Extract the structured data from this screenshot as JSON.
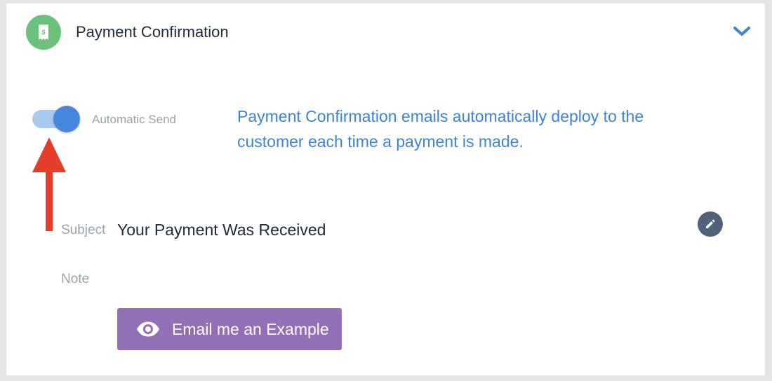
{
  "header": {
    "title": "Payment Confirmation",
    "icon": "receipt-dollar-icon",
    "icon_color": "#6cc17a",
    "chevron_icon": "chevron-down-icon"
  },
  "auto_send": {
    "label": "Automatic Send",
    "enabled": true,
    "track_color": "#a9c8ee",
    "knob_color": "#4687dd"
  },
  "description": "Payment Confirmation emails automatically deploy to the customer each time a payment is made.",
  "annotation": {
    "icon": "red-arrow-up",
    "color": "#e63c2a"
  },
  "subject": {
    "label": "Subject",
    "value": "Your Payment Was Received",
    "edit_icon": "pencil-icon"
  },
  "note": {
    "label": "Note"
  },
  "email_example_button": {
    "label": "Email me an Example",
    "icon": "eye-icon",
    "color": "#9170b6"
  },
  "colors": {
    "accent_blue": "#3d84d5",
    "text_dark": "#1f2a3a",
    "text_muted": "#9aa3ad"
  }
}
